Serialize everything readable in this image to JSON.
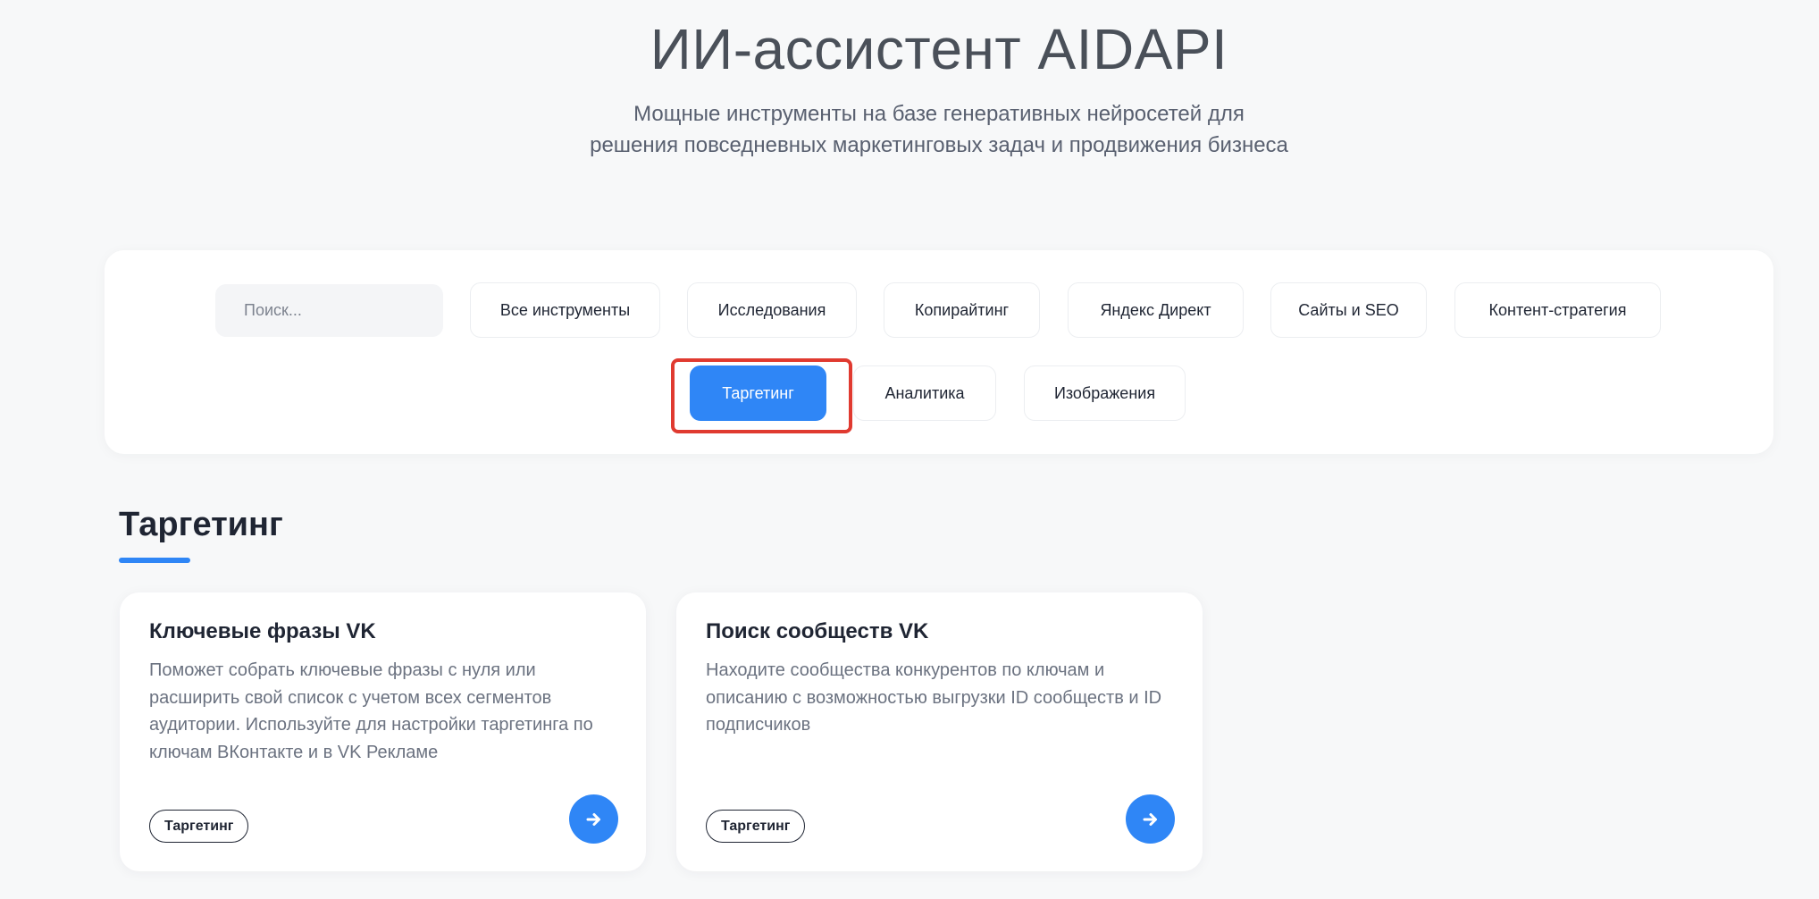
{
  "hero": {
    "title": "ИИ-ассистент AIDAPI",
    "subtitle_line1": "Мощные инструменты на базе генеративных нейросетей для",
    "subtitle_line2": "решения повседневных маркетинговых задач и продвижения бизнеса"
  },
  "filters": {
    "search_placeholder": "Поиск...",
    "buttons": [
      "Все инструменты",
      "Исследования",
      "Копирайтинг",
      "Яндекс Директ",
      "Сайты и SEO",
      "Контент-стратегия",
      "Таргетинг",
      "Аналитика",
      "Изображения"
    ],
    "active": "Таргетинг"
  },
  "section": {
    "title": "Таргетинг"
  },
  "cards": [
    {
      "title": "Ключевые фразы VK",
      "description": "Поможет собрать ключевые фразы с нуля или расширить свой список с учетом всех сегментов аудитории. Используйте для настройки таргетинга по ключам ВКонтакте и в VK Рекламе",
      "tag": "Таргетинг",
      "icon": "arrow-right-icon"
    },
    {
      "title": "Поиск сообществ VK",
      "description": "Находите сообщества конкурентов по ключам и описанию с возможностью выгрузки ID сообществ и ID подписчиков",
      "tag": "Таргетинг",
      "icon": "arrow-right-icon"
    }
  ],
  "colors": {
    "accent": "#2f86f6",
    "highlight": "#e03a30",
    "background": "#f7f8f9"
  }
}
